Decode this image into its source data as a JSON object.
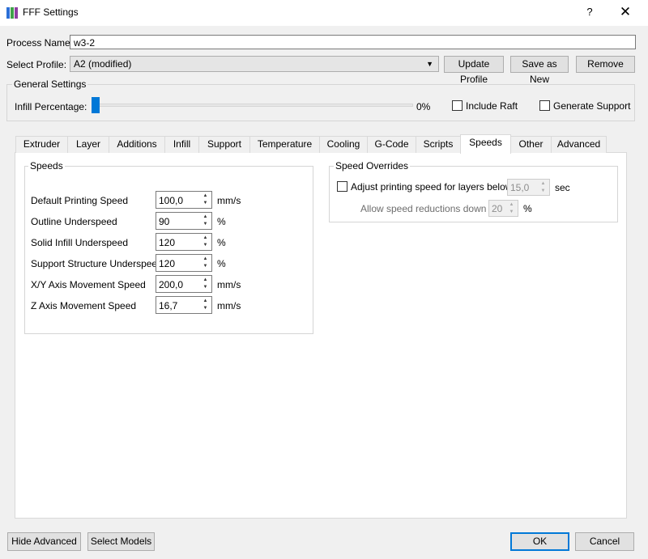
{
  "window": {
    "title": "FFF Settings",
    "help": "?",
    "close": "✕",
    "brand_colors": [
      "#2b6fd6",
      "#3fa24a",
      "#8e3fa1"
    ]
  },
  "process": {
    "name_label": "Process Name:",
    "name_value": "w3-2",
    "profile_label": "Select Profile:",
    "profile_value": "A2 (modified)",
    "update_profile": "Update Profile",
    "save_as_new": "Save as New",
    "remove": "Remove"
  },
  "general": {
    "title": "General Settings",
    "infill_label": "Infill Percentage:",
    "infill_value": "0%",
    "infill_fraction": 0,
    "include_raft": "Include Raft",
    "include_raft_checked": false,
    "generate_support": "Generate Support",
    "generate_support_checked": false
  },
  "tabs": [
    {
      "label": "Extruder"
    },
    {
      "label": "Layer"
    },
    {
      "label": "Additions"
    },
    {
      "label": "Infill"
    },
    {
      "label": "Support"
    },
    {
      "label": "Temperature"
    },
    {
      "label": "Cooling"
    },
    {
      "label": "G-Code"
    },
    {
      "label": "Scripts"
    },
    {
      "label": "Speeds",
      "active": true
    },
    {
      "label": "Other"
    },
    {
      "label": "Advanced"
    }
  ],
  "speeds": {
    "title": "Speeds",
    "rows": [
      {
        "label": "Default Printing Speed",
        "value": "100,0",
        "unit": "mm/s"
      },
      {
        "label": "Outline Underspeed",
        "value": "90",
        "unit": "%"
      },
      {
        "label": "Solid Infill Underspeed",
        "value": "120",
        "unit": "%"
      },
      {
        "label": "Support Structure Underspeed",
        "value": "120",
        "unit": "%"
      },
      {
        "label": "X/Y Axis Movement Speed",
        "value": "200,0",
        "unit": "mm/s"
      },
      {
        "label": "Z Axis Movement Speed",
        "value": "16,7",
        "unit": "mm/s"
      }
    ]
  },
  "overrides": {
    "title": "Speed Overrides",
    "adjust_label": "Adjust printing speed for layers below",
    "adjust_checked": false,
    "adjust_value": "15,0",
    "adjust_unit": "sec",
    "reduce_label": "Allow speed reductions down to",
    "reduce_value": "20",
    "reduce_unit": "%"
  },
  "footer": {
    "hide_advanced": "Hide Advanced",
    "select_models": "Select Models",
    "ok": "OK",
    "cancel": "Cancel"
  }
}
